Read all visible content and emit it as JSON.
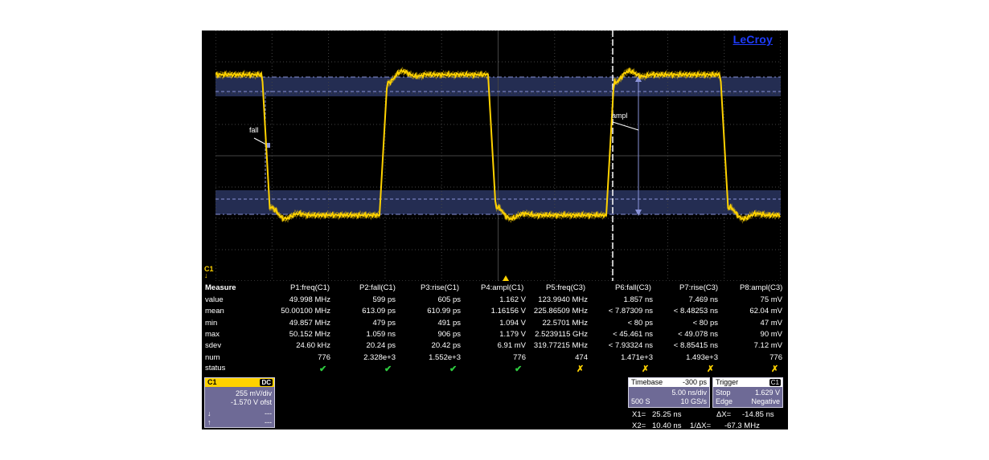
{
  "logo": "LeCroy",
  "markers": {
    "fall": "fall",
    "ampl": "ampl",
    "channel": "C1"
  },
  "measure": {
    "title": "Measure",
    "columns": [
      "P1:freq(C1)",
      "P2:fall(C1)",
      "P3:rise(C1)",
      "P4:ampl(C1)",
      "P5:freq(C3)",
      "P6:fall(C3)",
      "P7:rise(C3)",
      "P8:ampl(C3)"
    ],
    "rows": [
      {
        "label": "value",
        "cells": [
          "49.998 MHz",
          "599 ps",
          "605 ps",
          "1.162 V",
          "123.9940 MHz",
          "1.857 ns",
          "7.469 ns",
          "75 mV"
        ]
      },
      {
        "label": "mean",
        "cells": [
          "50.00100 MHz",
          "613.09 ps",
          "610.99 ps",
          "1.16156 V",
          "225.86509 MHz",
          "< 7.87309 ns",
          "< 8.48253 ns",
          "62.04 mV"
        ]
      },
      {
        "label": "min",
        "cells": [
          "49.857 MHz",
          "479 ps",
          "491 ps",
          "1.094 V",
          "22.5701 MHz",
          "< 80 ps",
          "< 80 ps",
          "47 mV"
        ]
      },
      {
        "label": "max",
        "cells": [
          "50.152 MHz",
          "1.059 ns",
          "906 ps",
          "1.179 V",
          "2.5239115 GHz",
          "< 45.461 ns",
          "< 49.078 ns",
          "90 mV"
        ]
      },
      {
        "label": "sdev",
        "cells": [
          "24.60 kHz",
          "20.24 ps",
          "20.42 ps",
          "6.91 mV",
          "319.77215 MHz",
          "< 7.93324 ns",
          "< 8.85415 ns",
          "7.12 mV"
        ]
      },
      {
        "label": "num",
        "cells": [
          "776",
          "2.328e+3",
          "1.552e+3",
          "776",
          "474",
          "1.471e+3",
          "1.493e+3",
          "776"
        ]
      }
    ],
    "status_label": "status",
    "status": [
      "ok",
      "ok",
      "ok",
      "ok",
      "warn",
      "warn",
      "warn",
      "warn"
    ]
  },
  "channel_panel": {
    "name": "C1",
    "tag": "DC",
    "scale": "255 mV/div",
    "offset": "-1.570 V ofst",
    "down_value": "---",
    "up_value": "---"
  },
  "timebase_panel": {
    "title": "Timebase",
    "delay": "-300 ps",
    "scale": "5.00 ns/div",
    "samples": "500 S",
    "rate": "10 GS/s"
  },
  "trigger_panel": {
    "title": "Trigger",
    "tag": "C1",
    "mode": "Stop",
    "level": "1.629 V",
    "type": "Edge",
    "slope": "Negative"
  },
  "cursors": {
    "x1_label": "X1=",
    "x1_value": "25.25 ns",
    "dx_label": "ΔX=",
    "dx_value": "-14.85 ns",
    "x2_label": "X2=",
    "x2_value": "10.40 ns",
    "inv_dx_label": "1/ΔX=",
    "inv_dx_value": "-67.3 MHz"
  },
  "colors": {
    "trace": "#ffd200",
    "accent_panel": "#6e6a96",
    "ok": "#2ecc40"
  }
}
